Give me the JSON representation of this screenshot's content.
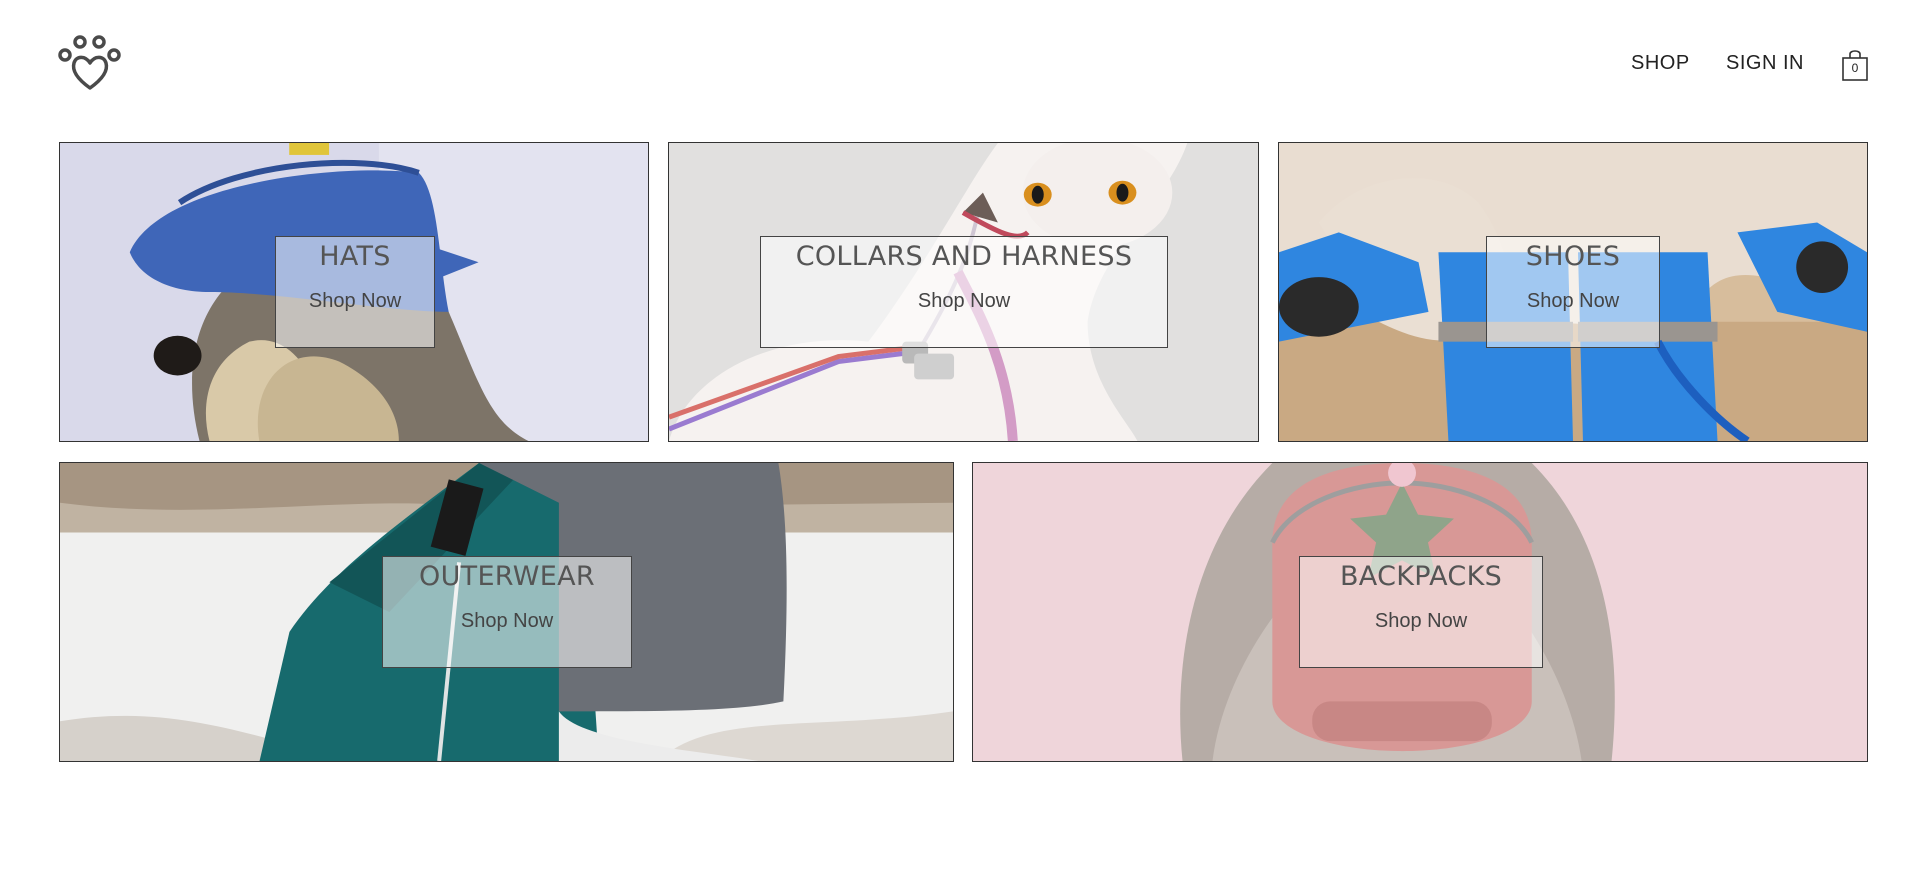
{
  "header": {
    "logo_icon": "paw-heart-icon",
    "nav": {
      "shop_label": "SHOP",
      "signin_label": "SIGN IN"
    },
    "cart": {
      "icon": "shopping-bag-icon",
      "count": "0"
    }
  },
  "categories": [
    {
      "title": "HATS",
      "cta": "Shop Now",
      "image": "dog-in-blue-crochet-visor"
    },
    {
      "title": "COLLARS AND HARNESS",
      "cta": "Shop Now",
      "image": "white-cat-with-pink-harness"
    },
    {
      "title": "SHOES",
      "cta": "Shop Now",
      "image": "dog-wearing-blue-boots"
    },
    {
      "title": "OUTERWEAR",
      "cta": "Shop Now",
      "image": "dog-in-teal-winter-coat-snow"
    },
    {
      "title": "BACKPACKS",
      "cta": "Shop Now",
      "image": "pink-pet-backpack-with-star"
    }
  ],
  "colors": {
    "border": "#333333",
    "label_text": "#555555",
    "overlay": "rgba(255,255,255,0.55)"
  }
}
